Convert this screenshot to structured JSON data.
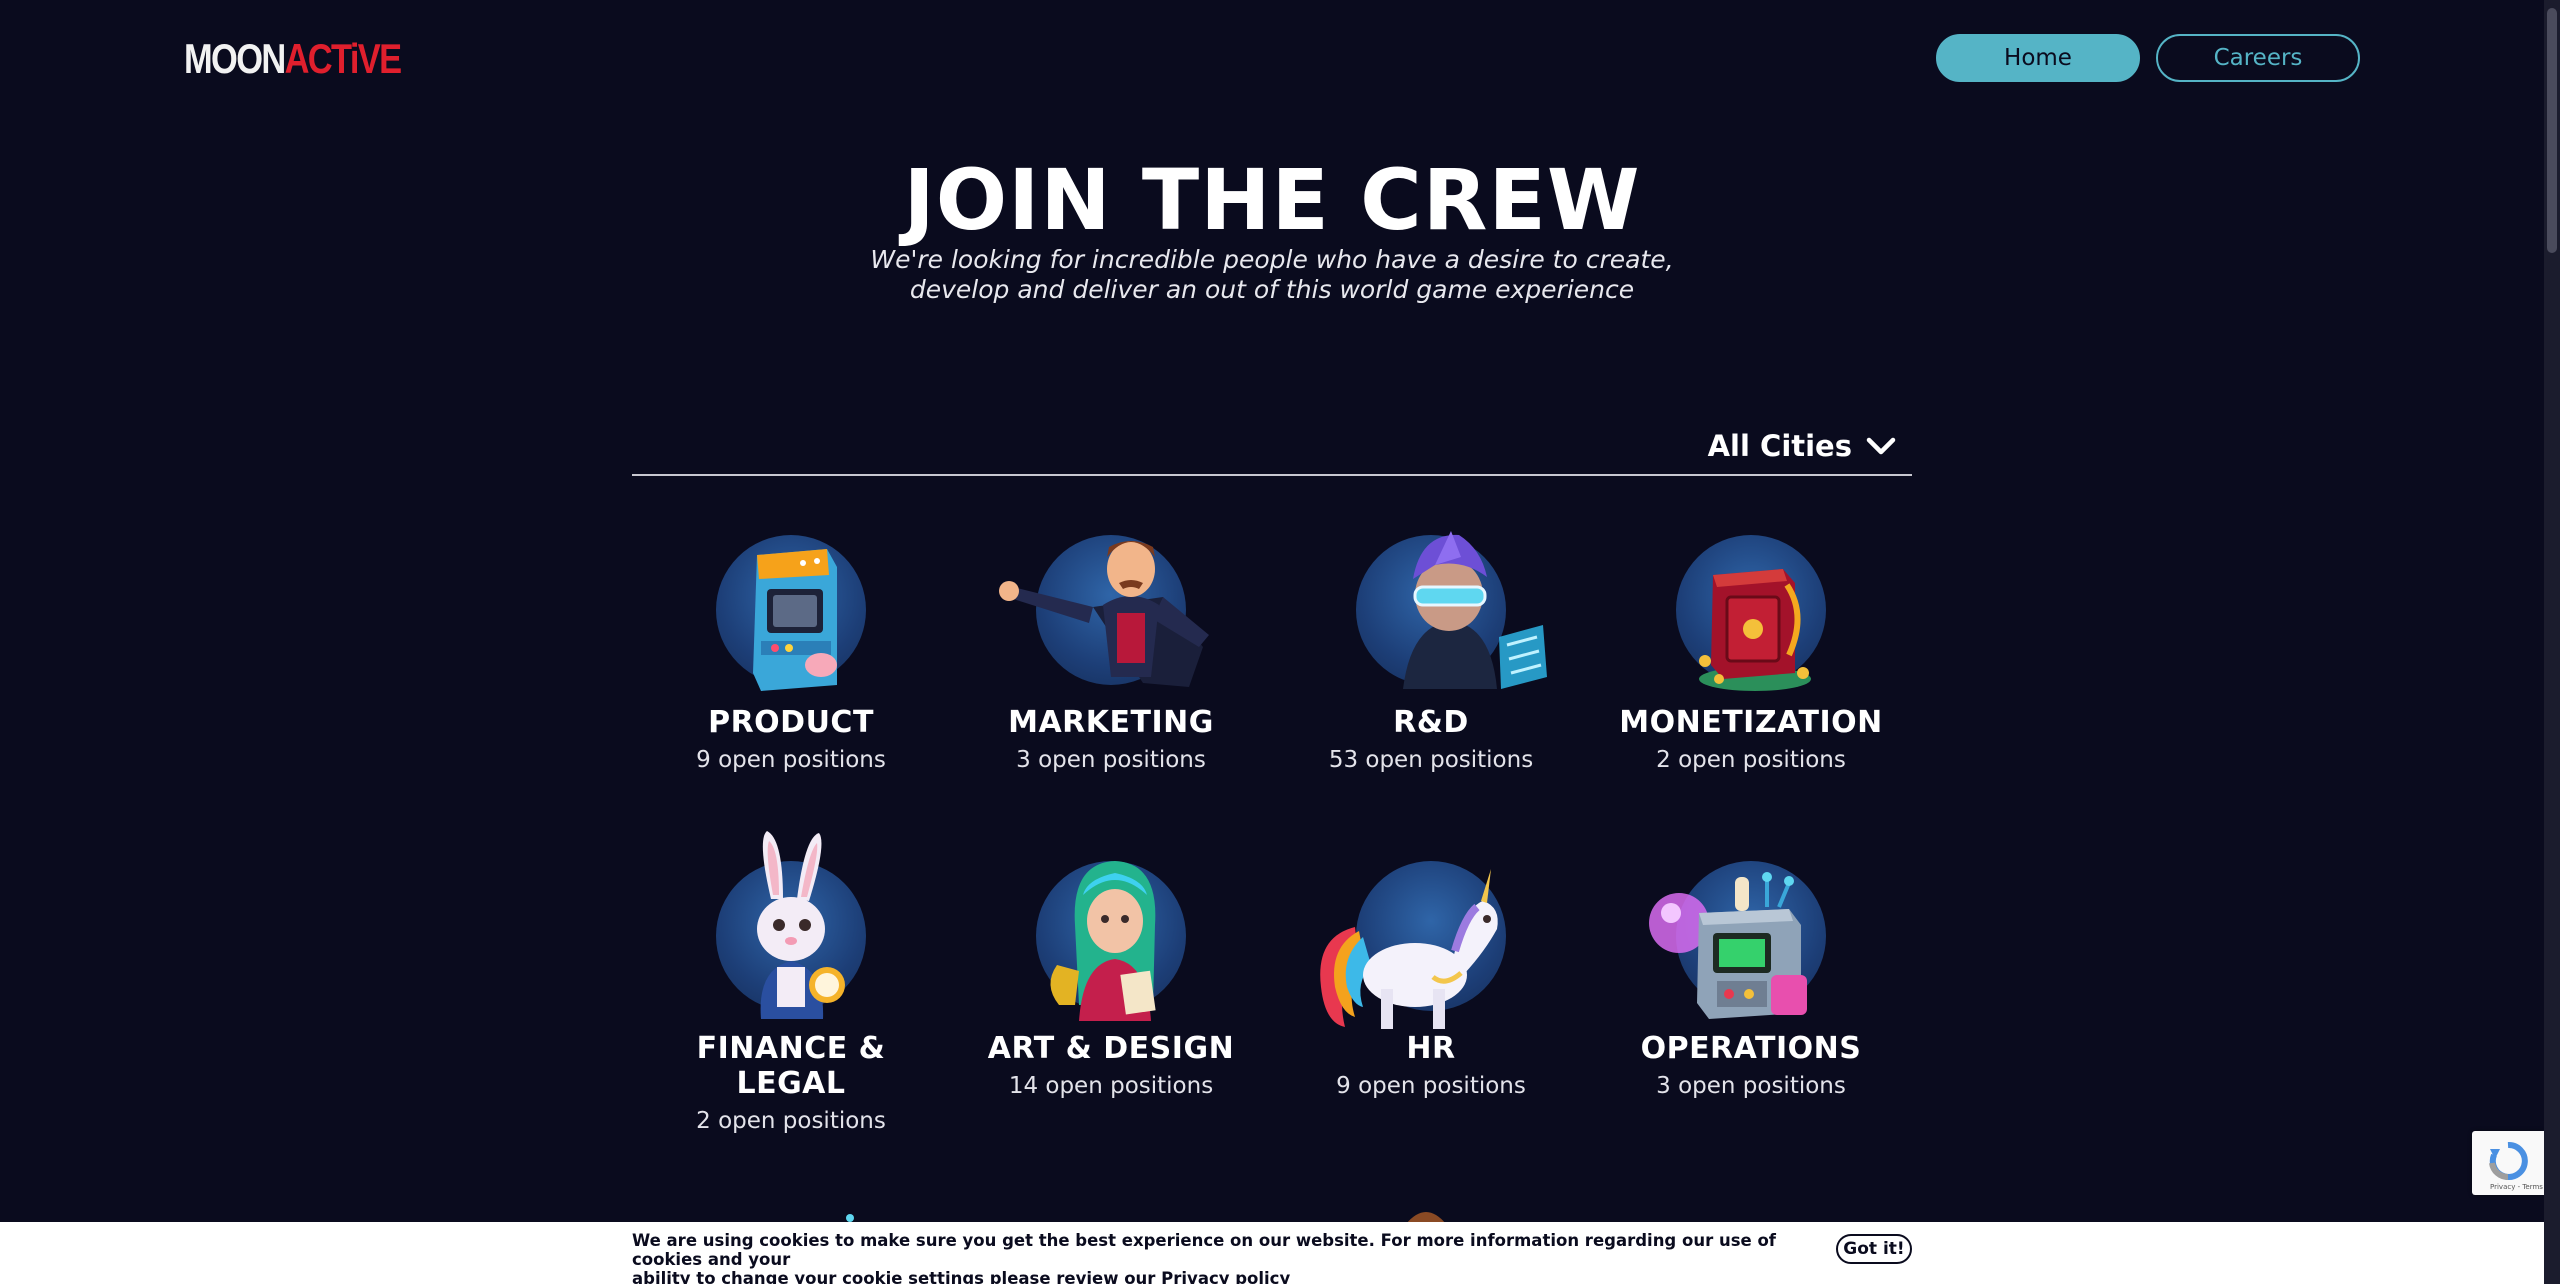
{
  "header": {
    "logo_moon": "MOON",
    "logo_active": "ACTiVE",
    "nav": {
      "home": "Home",
      "careers": "Careers"
    }
  },
  "hero": {
    "title": "JOIN THE CREW",
    "subtitle_line1": "We're looking for incredible people who have a desire to create,",
    "subtitle_line2": "develop and deliver an out of this world game experience"
  },
  "filter": {
    "city_label": "All Cities",
    "icon": "chevron-down-icon"
  },
  "departments": [
    {
      "name": "PRODUCT",
      "count": "9 open positions",
      "icon": "arcade-machine-icon"
    },
    {
      "name": "MARKETING",
      "count": "3 open positions",
      "icon": "showman-character-icon"
    },
    {
      "name": "R&D",
      "count": "53 open positions",
      "icon": "cyber-character-icon"
    },
    {
      "name": "MONETIZATION",
      "count": "2 open positions",
      "icon": "treasure-safe-icon"
    },
    {
      "name": "FINANCE &",
      "name2": "LEGAL",
      "count": "2 open positions",
      "icon": "rabbit-clock-icon"
    },
    {
      "name": "ART & DESIGN",
      "count": "14 open positions",
      "icon": "artist-girl-icon"
    },
    {
      "name": "HR",
      "count": "9 open positions",
      "icon": "unicorn-icon"
    },
    {
      "name": "OPERATIONS",
      "count": "3 open positions",
      "icon": "control-machine-icon"
    }
  ],
  "cookie": {
    "text_line1": "We are using cookies to make sure you get the best experience on our website. For more information regarding our use of cookies and your",
    "text_line2": "ability to change your cookie settings please review our",
    "link": "Privacy policy",
    "button": "Got it!"
  },
  "recaptcha": {
    "text": "Privacy - Terms"
  },
  "colors": {
    "background": "#0a0b1e",
    "accent": "#55b4c6",
    "logo_red": "#e01f2d",
    "circle_blue": "#1d3f78"
  }
}
